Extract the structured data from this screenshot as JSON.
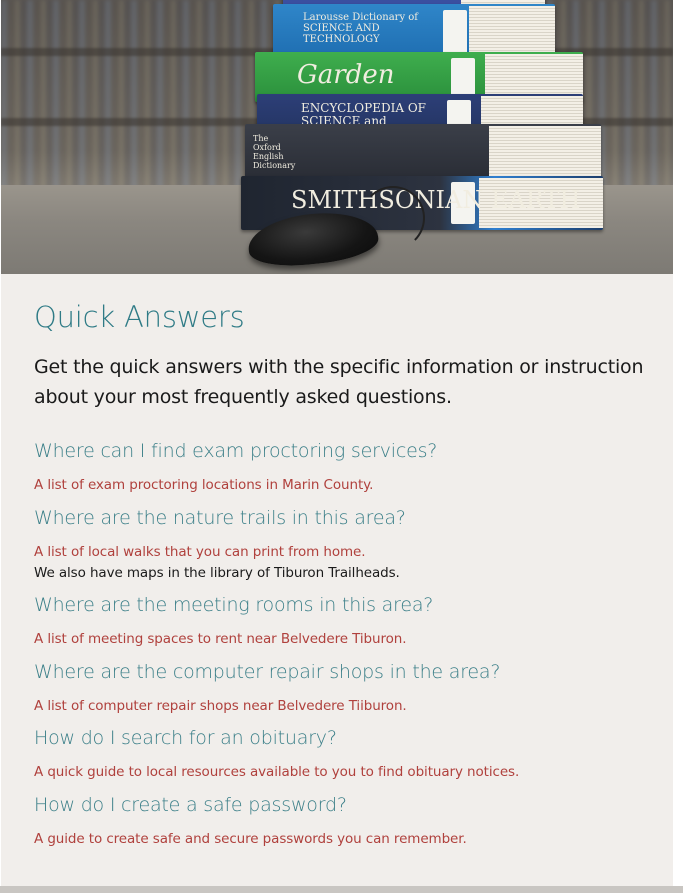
{
  "hero": {
    "book_titles": [
      "Larousse Dictionary of SCIENCE AND TECHNOLOGY",
      "Garden",
      "ENCYCLOPEDIA OF SCIENCE and TECHNOLOGY",
      "The Oxford English Dictionary",
      "SMITHSONIAN EARTH"
    ]
  },
  "main": {
    "title": "Quick Answers",
    "intro": "Get the quick answers with the  specific information or instruction about your most frequently asked questions."
  },
  "faqs": [
    {
      "question": "Where can I find exam proctoring services?",
      "answer": "A list of exam proctoring locations in Marin County."
    },
    {
      "question": "Where are the nature trails in this area?",
      "answer": "A list of local walks that you can print from home.",
      "note": "We also have maps in the library of Tiburon Trailheads."
    },
    {
      "question": "Where are the meeting rooms in this area?",
      "answer": "A list of meeting spaces to rent near Belvedere Tiburon."
    },
    {
      "question": "Where are the computer repair shops in the area?",
      "answer": "A list of computer repair shops near Belvedere Tiiburon."
    },
    {
      "question": "How do I search for an obituary?",
      "answer": "A quick guide to local resources available to you to find obituary notices."
    },
    {
      "question": "How do I create a safe password?",
      "answer": "A guide to create safe and secure passwords you can remember."
    }
  ],
  "colors": {
    "heading": "#2f7b86",
    "link": "#b0413d",
    "panel": "#f1eeeb"
  }
}
